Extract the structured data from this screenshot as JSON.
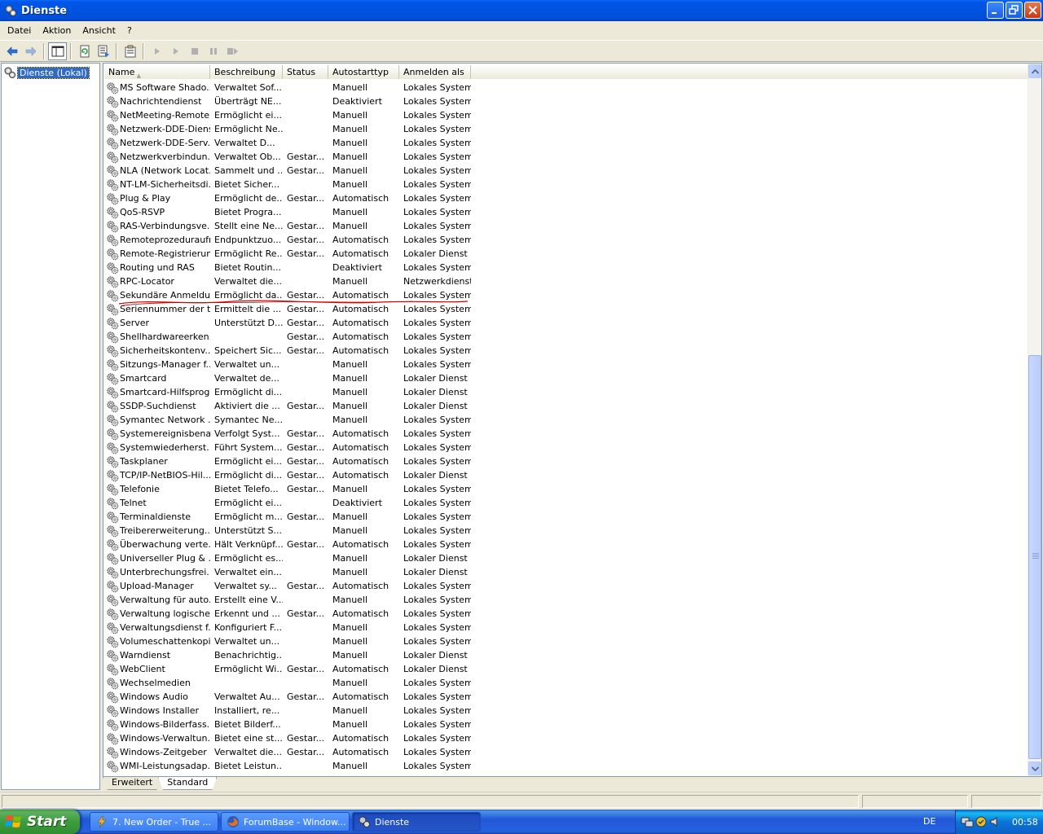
{
  "window": {
    "title": "Dienste",
    "icon": "services-gear-icon"
  },
  "menu": [
    "Datei",
    "Aktion",
    "Ansicht",
    "?"
  ],
  "tree": {
    "root_label": "Dienste (Lokal)"
  },
  "columns": {
    "name": "Name",
    "desc": "Beschreibung",
    "status": "Status",
    "start": "Autostarttyp",
    "logon": "Anmelden als"
  },
  "rows": [
    [
      "MS Software Shado...",
      "Verwaltet Sof...",
      "",
      "Manuell",
      "Lokales System"
    ],
    [
      "Nachrichtendienst",
      "Überträgt NE...",
      "",
      "Deaktiviert",
      "Lokales System"
    ],
    [
      "NetMeeting-Remote...",
      "Ermöglicht ei...",
      "",
      "Manuell",
      "Lokales System"
    ],
    [
      "Netzwerk-DDE-Dienst",
      "Ermöglicht Ne...",
      "",
      "Manuell",
      "Lokales System"
    ],
    [
      "Netzwerk-DDE-Serv...",
      "Verwaltet  D...",
      "",
      "Manuell",
      "Lokales System"
    ],
    [
      "Netzwerkverbindun...",
      "Verwaltet Ob...",
      "Gestar...",
      "Manuell",
      "Lokales System"
    ],
    [
      "NLA (Network Locat...",
      "Sammelt und ...",
      "Gestar...",
      "Manuell",
      "Lokales System"
    ],
    [
      "NT-LM-Sicherheitsdi...",
      "Bietet Sicher...",
      "",
      "Manuell",
      "Lokales System"
    ],
    [
      "Plug & Play",
      "Ermöglicht de...",
      "Gestar...",
      "Automatisch",
      "Lokales System"
    ],
    [
      "QoS-RSVP",
      "Bietet Progra...",
      "",
      "Manuell",
      "Lokales System"
    ],
    [
      "RAS-Verbindungsve...",
      "Stellt eine Ne...",
      "Gestar...",
      "Manuell",
      "Lokales System"
    ],
    [
      "Remoteprozeduraufr...",
      "Endpunktzuo...",
      "Gestar...",
      "Automatisch",
      "Lokales System"
    ],
    [
      "Remote-Registrierung",
      "Ermöglicht Re...",
      "Gestar...",
      "Automatisch",
      "Lokaler Dienst"
    ],
    [
      "Routing und RAS",
      "Bietet Routin...",
      "",
      "Deaktiviert",
      "Lokales System"
    ],
    [
      "RPC-Locator",
      "Verwaltet die...",
      "",
      "Manuell",
      "Netzwerkdienst"
    ],
    [
      "Sekundäre Anmeldung",
      "Ermöglicht da...",
      "Gestar...",
      "Automatisch",
      "Lokales System"
    ],
    [
      "Seriennummer der t...",
      "Ermittelt die ...",
      "Gestar...",
      "Automatisch",
      "Lokales System"
    ],
    [
      "Server",
      "Unterstützt D...",
      "Gestar...",
      "Automatisch",
      "Lokales System"
    ],
    [
      "Shellhardwareerken...",
      "",
      "Gestar...",
      "Automatisch",
      "Lokales System"
    ],
    [
      "Sicherheitskontenv...",
      "Speichert Sic...",
      "Gestar...",
      "Automatisch",
      "Lokales System"
    ],
    [
      "Sitzungs-Manager f...",
      "Verwaltet un...",
      "",
      "Manuell",
      "Lokales System"
    ],
    [
      "Smartcard",
      "Verwaltet de...",
      "",
      "Manuell",
      "Lokaler Dienst"
    ],
    [
      "Smartcard-Hilfsprog...",
      "Ermöglicht di...",
      "",
      "Manuell",
      "Lokaler Dienst"
    ],
    [
      "SSDP-Suchdienst",
      "Aktiviert die ...",
      "Gestar...",
      "Manuell",
      "Lokaler Dienst"
    ],
    [
      "Symantec Network ...",
      "Symantec Ne...",
      "",
      "Manuell",
      "Lokales System"
    ],
    [
      "Systemereignisbena...",
      "Verfolgt Syst...",
      "Gestar...",
      "Automatisch",
      "Lokales System"
    ],
    [
      "Systemwiederherst...",
      "Führt System...",
      "Gestar...",
      "Automatisch",
      "Lokales System"
    ],
    [
      "Taskplaner",
      "Ermöglicht ei...",
      "Gestar...",
      "Automatisch",
      "Lokales System"
    ],
    [
      "TCP/IP-NetBIOS-Hil...",
      "Ermöglicht di...",
      "Gestar...",
      "Automatisch",
      "Lokaler Dienst"
    ],
    [
      "Telefonie",
      "Bietet Telefo...",
      "Gestar...",
      "Manuell",
      "Lokales System"
    ],
    [
      "Telnet",
      "Ermöglicht ei...",
      "",
      "Deaktiviert",
      "Lokales System"
    ],
    [
      "Terminaldienste",
      "Ermöglicht m...",
      "Gestar...",
      "Manuell",
      "Lokales System"
    ],
    [
      "Treibererweiterung...",
      "Unterstützt S...",
      "",
      "Manuell",
      "Lokales System"
    ],
    [
      "Überwachung verte...",
      "Hält Verknüpf...",
      "Gestar...",
      "Automatisch",
      "Lokales System"
    ],
    [
      "Universeller Plug & ...",
      "Ermöglicht es...",
      "",
      "Manuell",
      "Lokaler Dienst"
    ],
    [
      "Unterbrechungsfrei...",
      "Verwaltet ein...",
      "",
      "Manuell",
      "Lokaler Dienst"
    ],
    [
      "Upload-Manager",
      "Verwaltet sy...",
      "Gestar...",
      "Automatisch",
      "Lokales System"
    ],
    [
      "Verwaltung für auto...",
      "Erstellt eine V...",
      "",
      "Manuell",
      "Lokales System"
    ],
    [
      "Verwaltung logische...",
      "Erkennt und ...",
      "Gestar...",
      "Automatisch",
      "Lokales System"
    ],
    [
      "Verwaltungsdienst f...",
      "Konfiguriert F...",
      "",
      "Manuell",
      "Lokales System"
    ],
    [
      "Volumeschattenkopie",
      "Verwaltet un...",
      "",
      "Manuell",
      "Lokales System"
    ],
    [
      "Warndienst",
      "Benachrichtig...",
      "",
      "Manuell",
      "Lokaler Dienst"
    ],
    [
      "WebClient",
      "Ermöglicht Wi...",
      "Gestar...",
      "Automatisch",
      "Lokaler Dienst"
    ],
    [
      "Wechselmedien",
      "",
      "",
      "Manuell",
      "Lokales System"
    ],
    [
      "Windows Audio",
      "Verwaltet Au...",
      "Gestar...",
      "Automatisch",
      "Lokales System"
    ],
    [
      "Windows Installer",
      "Installiert, re...",
      "",
      "Manuell",
      "Lokales System"
    ],
    [
      "Windows-Bilderfass...",
      "Bietet Bilderf...",
      "",
      "Manuell",
      "Lokales System"
    ],
    [
      "Windows-Verwaltun...",
      "Bietet eine st...",
      "Gestar...",
      "Automatisch",
      "Lokales System"
    ],
    [
      "Windows-Zeitgeber",
      "Verwaltet die...",
      "Gestar...",
      "Automatisch",
      "Lokales System"
    ],
    [
      "WMI-Leistungsadap...",
      "Bietet Leistun...",
      "",
      "Manuell",
      "Lokales System"
    ]
  ],
  "tabs": [
    "Erweitert",
    "Standard"
  ],
  "active_tab": "Standard",
  "taskbar": {
    "start_label": "Start",
    "tasks": [
      "7. New Order - True ...",
      "ForumBase - Window...",
      "Dienste"
    ],
    "language": "DE",
    "clock": "00:58"
  },
  "annotation_color": "#d00000"
}
